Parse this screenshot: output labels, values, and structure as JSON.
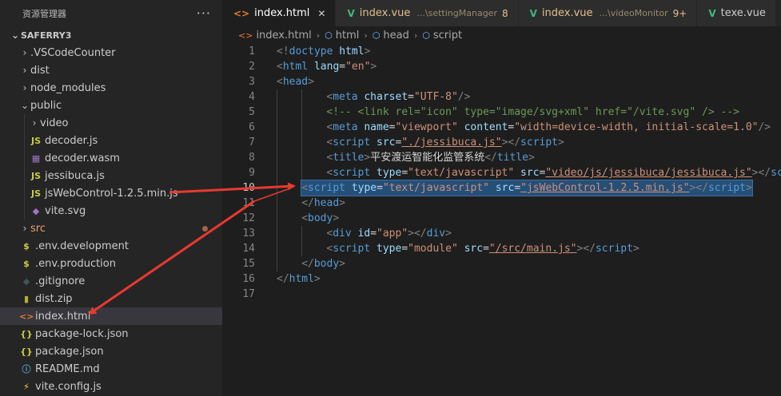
{
  "explorer": {
    "title": "资源管理器",
    "more": "···",
    "project": "SAFERRY3",
    "items": [
      {
        "name": ".VSCodeCounter",
        "kind": "folder",
        "depth": 1,
        "open": false,
        "icon": "",
        "icon_color": ""
      },
      {
        "name": "dist",
        "kind": "folder",
        "depth": 1,
        "open": false,
        "icon": "",
        "icon_color": ""
      },
      {
        "name": "node_modules",
        "kind": "folder",
        "depth": 1,
        "open": false,
        "icon": "",
        "icon_color": ""
      },
      {
        "name": "public",
        "kind": "folder",
        "depth": 1,
        "open": true,
        "icon": "",
        "icon_color": ""
      },
      {
        "name": "video",
        "kind": "folder",
        "depth": 2,
        "open": false,
        "icon": "",
        "icon_color": ""
      },
      {
        "name": "decoder.js",
        "kind": "file",
        "depth": 2,
        "icon": "JS",
        "icon_color": "#cbcb41"
      },
      {
        "name": "decoder.wasm",
        "kind": "file",
        "depth": 2,
        "icon": "▦",
        "icon_color": "#a074c4"
      },
      {
        "name": "jessibuca.js",
        "kind": "file",
        "depth": 2,
        "icon": "JS",
        "icon_color": "#cbcb41"
      },
      {
        "name": "jsWebControl-1.2.5.min.js",
        "kind": "file",
        "depth": 2,
        "icon": "JS",
        "icon_color": "#cbcb41"
      },
      {
        "name": "vite.svg",
        "kind": "file",
        "depth": 2,
        "icon": "◆",
        "icon_color": "#a074c4"
      },
      {
        "name": "src",
        "kind": "folder",
        "depth": 1,
        "open": false,
        "icon": "",
        "icon_color": "",
        "modified": true
      },
      {
        "name": ".env.development",
        "kind": "file",
        "depth": 1,
        "icon": "$",
        "icon_color": "#cbcb41"
      },
      {
        "name": ".env.production",
        "kind": "file",
        "depth": 1,
        "icon": "$",
        "icon_color": "#cbcb41"
      },
      {
        "name": ".gitignore",
        "kind": "file",
        "depth": 1,
        "icon": "◆",
        "icon_color": "#41535b"
      },
      {
        "name": "dist.zip",
        "kind": "file",
        "depth": 1,
        "icon": "▮",
        "icon_color": "#afb42b"
      },
      {
        "name": "index.html",
        "kind": "file",
        "depth": 1,
        "icon": "<>",
        "icon_color": "#e37933",
        "selected": true
      },
      {
        "name": "package-lock.json",
        "kind": "file",
        "depth": 1,
        "icon": "{}",
        "icon_color": "#cbcb41"
      },
      {
        "name": "package.json",
        "kind": "file",
        "depth": 1,
        "icon": "{}",
        "icon_color": "#cbcb41"
      },
      {
        "name": "README.md",
        "kind": "file",
        "depth": 1,
        "icon": "ⓘ",
        "icon_color": "#519aba"
      },
      {
        "name": "vite.config.js",
        "kind": "file",
        "depth": 1,
        "icon": "⚡",
        "icon_color": "#ffd43b"
      }
    ]
  },
  "tabs": [
    {
      "label": "index.html",
      "icon": "<>",
      "icon_type": "html",
      "desc": "",
      "badge": "",
      "active": true,
      "close": "✕"
    },
    {
      "label": "index.vue",
      "icon": "V",
      "icon_type": "vue",
      "desc": "...\\settingManager",
      "badge": "8",
      "active": false,
      "close": ""
    },
    {
      "label": "index.vue",
      "icon": "V",
      "icon_type": "vue",
      "desc": "...\\videoMonitor",
      "badge": "9+",
      "active": false,
      "close": ""
    },
    {
      "label": "texe.vue",
      "icon": "V",
      "icon_type": "vue",
      "desc": "",
      "badge": "",
      "active": false,
      "close": "",
      "plain": true
    }
  ],
  "breadcrumb": [
    {
      "label": "index.html",
      "icon": "<>"
    },
    {
      "label": "html",
      "icon": "⬡"
    },
    {
      "label": "head",
      "icon": "⬡"
    },
    {
      "label": "script",
      "icon": "⬡"
    }
  ],
  "breadcrumb_sep": "›",
  "editor": {
    "current_line": 10,
    "lines": [
      {
        "n": "1",
        "indent": 0,
        "tokens": [
          [
            "t",
            "<!"
          ],
          [
            "tg",
            "doctype"
          ],
          [
            "tx",
            " "
          ],
          [
            "at",
            "html"
          ],
          [
            "t",
            ">"
          ]
        ]
      },
      {
        "n": "2",
        "indent": 0,
        "tokens": [
          [
            "t",
            "<"
          ],
          [
            "tg",
            "html"
          ],
          [
            "tx",
            " "
          ],
          [
            "at",
            "lang"
          ],
          [
            "tx",
            "="
          ],
          [
            "st",
            "\"en\""
          ],
          [
            "t",
            ">"
          ]
        ]
      },
      {
        "n": "3",
        "indent": 0,
        "tokens": [
          [
            "t",
            "<"
          ],
          [
            "tg",
            "head"
          ],
          [
            "t",
            ">"
          ]
        ]
      },
      {
        "n": "4",
        "indent": 2,
        "tokens": [
          [
            "t",
            "<"
          ],
          [
            "tg",
            "meta"
          ],
          [
            "tx",
            " "
          ],
          [
            "at",
            "charset"
          ],
          [
            "tx",
            "="
          ],
          [
            "st",
            "\"UTF-8\""
          ],
          [
            "t",
            "/>"
          ]
        ]
      },
      {
        "n": "5",
        "indent": 2,
        "tokens": [
          [
            "cm",
            "<!-- <link rel=\"icon\" type=\"image/svg+xml\" href=\"/vite.svg\" /> -->"
          ]
        ]
      },
      {
        "n": "6",
        "indent": 2,
        "tokens": [
          [
            "t",
            "<"
          ],
          [
            "tg",
            "meta"
          ],
          [
            "tx",
            " "
          ],
          [
            "at",
            "name"
          ],
          [
            "tx",
            "="
          ],
          [
            "st",
            "\"viewport\""
          ],
          [
            "tx",
            " "
          ],
          [
            "at",
            "content"
          ],
          [
            "tx",
            "="
          ],
          [
            "st",
            "\"width=device-width, initial-scale=1.0\""
          ],
          [
            "t",
            "/>"
          ]
        ]
      },
      {
        "n": "7",
        "indent": 2,
        "tokens": [
          [
            "t",
            "<"
          ],
          [
            "tg",
            "script"
          ],
          [
            "tx",
            " "
          ],
          [
            "at",
            "src"
          ],
          [
            "tx",
            "="
          ],
          [
            "st",
            "\"./jessibuca.js\""
          ],
          [
            "t",
            "></"
          ],
          [
            "tg",
            "script"
          ],
          [
            "t",
            ">"
          ]
        ]
      },
      {
        "n": "8",
        "indent": 2,
        "tokens": [
          [
            "t",
            "<"
          ],
          [
            "tg",
            "title"
          ],
          [
            "t",
            ">"
          ],
          [
            "tx",
            "平安渡运智能化监管系统"
          ],
          [
            "t",
            "</"
          ],
          [
            "tg",
            "title"
          ],
          [
            "t",
            ">"
          ]
        ]
      },
      {
        "n": "9",
        "indent": 2,
        "tokens": [
          [
            "t",
            "<"
          ],
          [
            "tg",
            "script"
          ],
          [
            "tx",
            " "
          ],
          [
            "at",
            "type"
          ],
          [
            "tx",
            "="
          ],
          [
            "st",
            "\"text/javascript\""
          ],
          [
            "tx",
            " "
          ],
          [
            "at",
            "src"
          ],
          [
            "tx",
            "="
          ],
          [
            "st",
            "\"video/js/jessibuca/jessibuca.js\""
          ],
          [
            "t",
            "></"
          ],
          [
            "tg",
            "script"
          ],
          [
            "t",
            ">"
          ]
        ]
      },
      {
        "n": "10",
        "indent": 1,
        "highlight": true,
        "tokens": [
          [
            "t",
            "<"
          ],
          [
            "tg",
            "script"
          ],
          [
            "tx",
            " "
          ],
          [
            "at",
            "type"
          ],
          [
            "tx",
            "="
          ],
          [
            "st",
            "\"text/javascript\""
          ],
          [
            "tx",
            " "
          ],
          [
            "at",
            "src"
          ],
          [
            "tx",
            "="
          ],
          [
            "st",
            "\"jsWebControl-1.2.5.min.js\""
          ],
          [
            "t",
            "></"
          ],
          [
            "tg",
            "script"
          ],
          [
            "t",
            ">"
          ]
        ]
      },
      {
        "n": "11",
        "indent": 1,
        "tokens": [
          [
            "t",
            "</"
          ],
          [
            "tg",
            "head"
          ],
          [
            "t",
            ">"
          ]
        ]
      },
      {
        "n": "12",
        "indent": 1,
        "tokens": [
          [
            "t",
            "<"
          ],
          [
            "tg",
            "body"
          ],
          [
            "t",
            ">"
          ]
        ]
      },
      {
        "n": "13",
        "indent": 2,
        "tokens": [
          [
            "t",
            "<"
          ],
          [
            "tg",
            "div"
          ],
          [
            "tx",
            " "
          ],
          [
            "at",
            "id"
          ],
          [
            "tx",
            "="
          ],
          [
            "st",
            "\"app\""
          ],
          [
            "t",
            "></"
          ],
          [
            "tg",
            "div"
          ],
          [
            "t",
            ">"
          ]
        ]
      },
      {
        "n": "14",
        "indent": 2,
        "tokens": [
          [
            "t",
            "<"
          ],
          [
            "tg",
            "script"
          ],
          [
            "tx",
            " "
          ],
          [
            "at",
            "type"
          ],
          [
            "tx",
            "="
          ],
          [
            "st",
            "\"module\""
          ],
          [
            "tx",
            " "
          ],
          [
            "at",
            "src"
          ],
          [
            "tx",
            "="
          ],
          [
            "st",
            "\"/src/main.js\""
          ],
          [
            "t",
            "></"
          ],
          [
            "tg",
            "script"
          ],
          [
            "t",
            ">"
          ]
        ]
      },
      {
        "n": "15",
        "indent": 1,
        "tokens": [
          [
            "t",
            "</"
          ],
          [
            "tg",
            "body"
          ],
          [
            "t",
            ">"
          ]
        ]
      },
      {
        "n": "16",
        "indent": 0,
        "tokens": [
          [
            "t",
            "</"
          ],
          [
            "tg",
            "html"
          ],
          [
            "t",
            ">"
          ]
        ]
      },
      {
        "n": "17",
        "indent": 0,
        "tokens": []
      }
    ]
  },
  "colors": {
    "accent_html": "#e37933",
    "accent_vue": "#41b883",
    "annotation_arrow": "#e8392f",
    "selection": "#264f78"
  }
}
